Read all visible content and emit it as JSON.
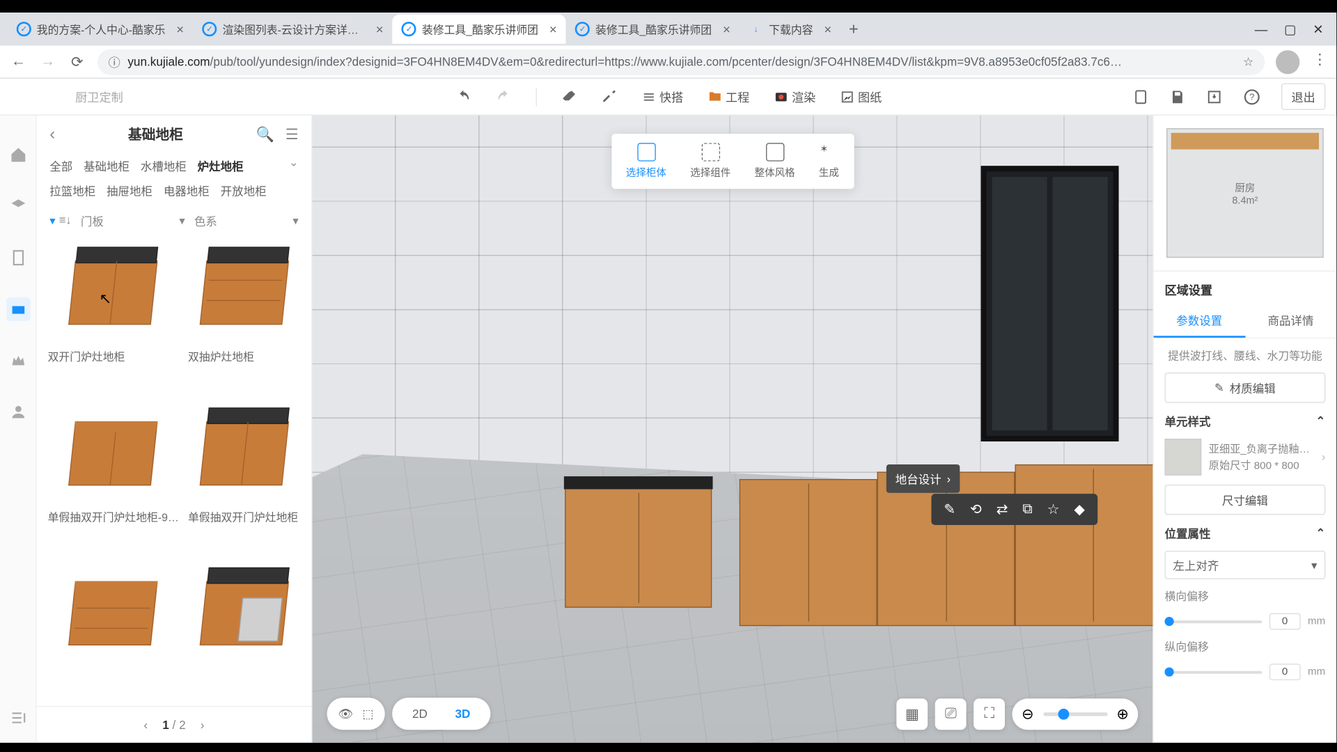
{
  "browser": {
    "tabs": [
      {
        "label": "我的方案-个人中心-酷家乐",
        "active": false
      },
      {
        "label": "渲染图列表-云设计方案详情-酷",
        "active": false
      },
      {
        "label": "装修工具_酷家乐讲师团",
        "active": true
      },
      {
        "label": "装修工具_酷家乐讲师团",
        "active": false
      },
      {
        "label": "下载内容",
        "active": false,
        "dl": true
      }
    ],
    "url_prefix": "yun.kujiale.com",
    "url_rest": "/pub/tool/yundesign/index?designid=3FO4HN8EM4DV&em=0&redirecturl=https://www.kujiale.com/pcenter/design/3FO4HN8EM4DV/list&kpm=9V8.a8953e0cf05f2a83.7c6…"
  },
  "toolbar": {
    "context": "厨卫定制",
    "quickbuild": "快搭",
    "project": "工程",
    "render": "渲染",
    "drawing": "图纸",
    "exit": "退出"
  },
  "floating_mode": {
    "items": [
      "选择柜体",
      "选择组件",
      "整体风格",
      "生成"
    ],
    "active": 0
  },
  "left_panel": {
    "title": "基础地柜",
    "categories": [
      "全部",
      "基础地柜",
      "水槽地柜",
      "炉灶地柜",
      "拉篮地柜",
      "抽屉地柜",
      "电器地柜",
      "开放地柜"
    ],
    "active_category": 3,
    "filter_door": "门板",
    "filter_color": "色系",
    "products": [
      "双开门炉灶地柜",
      "双抽炉灶地柜",
      "单假抽双开门炉灶地柜-9…",
      "单假抽双开门炉灶地柜",
      "",
      ""
    ],
    "page_current": "1",
    "page_total": "/ 2"
  },
  "context_chip": "地台设计",
  "view": {
    "mode2d": "2D",
    "mode3d": "3D"
  },
  "minimap": {
    "room_name": "厨房",
    "room_area": "8.4m²"
  },
  "right_panel": {
    "section_zone": "区域设置",
    "tab_params": "参数设置",
    "tab_details": "商品详情",
    "note": "提供波打线、腰线、水刀等功能",
    "btn_material": "材质编辑",
    "section_unit": "单元样式",
    "material_name": "亚细亚_负离子抛釉…",
    "material_size": "原始尺寸 800 * 800",
    "btn_size": "尺寸编辑",
    "section_pos": "位置属性",
    "align_value": "左上对齐",
    "offset_h_label": "横向偏移",
    "offset_v_label": "纵向偏移",
    "offset_value": "0",
    "unit": "mm"
  }
}
